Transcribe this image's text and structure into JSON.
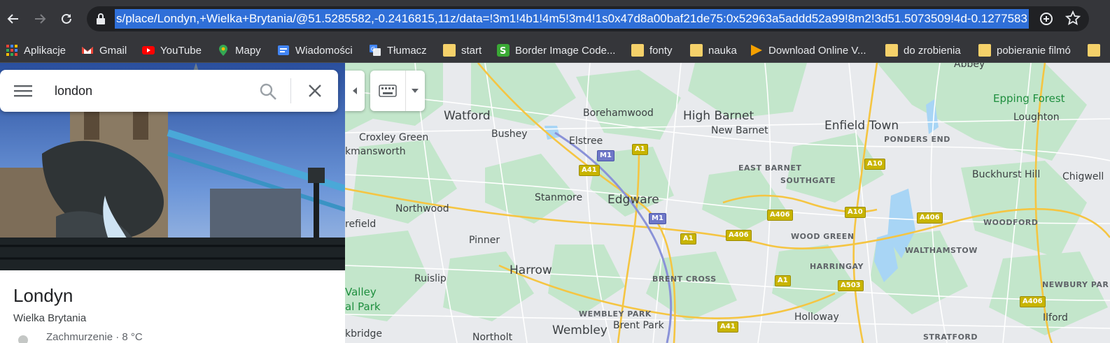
{
  "browser": {
    "url": "s/place/Londyn,+Wielka+Brytania/@51.5285582,-0.2416815,11z/data=!3m1!4b1!4m5!3m4!1s0x47d8a00baf21de75:0x52963a5addd52a99!8m2!3d51.5073509!4d-0.1277583"
  },
  "bookmarks": [
    {
      "label": "Aplikacje",
      "icon": "apps-grid-icon"
    },
    {
      "label": "Gmail",
      "icon": "gmail-icon"
    },
    {
      "label": "YouTube",
      "icon": "youtube-icon"
    },
    {
      "label": "Mapy",
      "icon": "maps-pin-icon"
    },
    {
      "label": "Wiadomości",
      "icon": "news-icon"
    },
    {
      "label": "Tłumacz",
      "icon": "translate-icon"
    },
    {
      "label": "start",
      "icon": "folder-icon"
    },
    {
      "label": "Border Image Code...",
      "icon": "border-image-icon"
    },
    {
      "label": "fonty",
      "icon": "folder-icon"
    },
    {
      "label": "nauka",
      "icon": "folder-icon"
    },
    {
      "label": "Download Online V...",
      "icon": "play-icon"
    },
    {
      "label": "do zrobienia",
      "icon": "folder-icon"
    },
    {
      "label": "pobieranie filmó",
      "icon": "folder-icon"
    }
  ],
  "search": {
    "value": "london"
  },
  "place": {
    "title": "Londyn",
    "subtitle": "Wielka Brytania",
    "weather": "Zachmurzenie · 8 °C"
  },
  "map": {
    "labels": [
      {
        "text": "Watford",
        "size": "big"
      },
      {
        "text": "Borehamwood",
        "size": "med"
      },
      {
        "text": "High Barnet",
        "size": "big"
      },
      {
        "text": "Enfield Town",
        "size": "big"
      },
      {
        "text": "Epping Forest",
        "size": "green"
      },
      {
        "text": "Loughton",
        "size": "med"
      },
      {
        "text": "Croxley Green",
        "size": "med"
      },
      {
        "text": "Bushey",
        "size": "med"
      },
      {
        "text": "New Barnet",
        "size": "med"
      },
      {
        "text": "PONDERS END",
        "size": "sm"
      },
      {
        "text": "kmansworth",
        "size": "med"
      },
      {
        "text": "Elstree",
        "size": "med"
      },
      {
        "text": "EAST BARNET",
        "size": "sm"
      },
      {
        "text": "SOUTHGATE",
        "size": "sm"
      },
      {
        "text": "Buckhurst Hill",
        "size": "med"
      },
      {
        "text": "Chigwell",
        "size": "med"
      },
      {
        "text": "Stanmore",
        "size": "med"
      },
      {
        "text": "Edgware",
        "size": "big"
      },
      {
        "text": "Northwood",
        "size": "med"
      },
      {
        "text": "WOODFORD",
        "size": "sm"
      },
      {
        "text": "refield",
        "size": "med"
      },
      {
        "text": "WOOD GREEN",
        "size": "sm"
      },
      {
        "text": "Pinner",
        "size": "med"
      },
      {
        "text": "WALTHAMSTOW",
        "size": "sm"
      },
      {
        "text": "HARRINGAY",
        "size": "sm"
      },
      {
        "text": "Harrow",
        "size": "big"
      },
      {
        "text": "Ruislip",
        "size": "med"
      },
      {
        "text": "BRENT CROSS",
        "size": "sm"
      },
      {
        "text": "NEWBURY PAR",
        "size": "sm"
      },
      {
        "text": "Valley",
        "size": "green"
      },
      {
        "text": "al Park",
        "size": "green"
      },
      {
        "text": "WEMBLEY PARK",
        "size": "sm"
      },
      {
        "text": "Holloway",
        "size": "med"
      },
      {
        "text": "Ilford",
        "size": "med"
      },
      {
        "text": "Brent Park",
        "size": "med"
      },
      {
        "text": "Wembley",
        "size": "big"
      },
      {
        "text": "kbridge",
        "size": "med"
      },
      {
        "text": "Northolt",
        "size": "med"
      },
      {
        "text": "STRATFORD",
        "size": "sm"
      },
      {
        "text": "Abbey",
        "size": "med"
      }
    ],
    "shields": [
      {
        "text": "M1",
        "type": "m"
      },
      {
        "text": "A1",
        "type": "a"
      },
      {
        "text": "A41",
        "type": "a"
      },
      {
        "text": "A10",
        "type": "a"
      },
      {
        "text": "M1",
        "type": "m"
      },
      {
        "text": "A406",
        "type": "a"
      },
      {
        "text": "A10",
        "type": "a"
      },
      {
        "text": "A406",
        "type": "a"
      },
      {
        "text": "A406",
        "type": "a"
      },
      {
        "text": "A1",
        "type": "a"
      },
      {
        "text": "A1",
        "type": "a"
      },
      {
        "text": "A503",
        "type": "a"
      },
      {
        "text": "A406",
        "type": "a"
      },
      {
        "text": "A41",
        "type": "a"
      }
    ]
  }
}
